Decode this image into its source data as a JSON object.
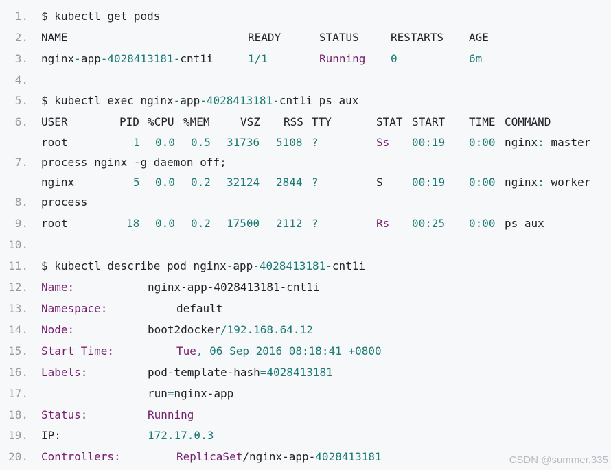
{
  "line_numbers": [
    "1.",
    "2.",
    "3.",
    "4.",
    "5.",
    "6.",
    "7.",
    "8.",
    "9.",
    "10.",
    "11.",
    "12.",
    "13.",
    "14.",
    "15.",
    "16.",
    "17.",
    "18.",
    "19.",
    "20."
  ],
  "cmd1": "$ kubectl get pods",
  "pods_header": {
    "name": "NAME",
    "ready": "READY",
    "status": "STATUS",
    "restarts": "RESTARTS",
    "age": "AGE"
  },
  "pod_row": {
    "name_a": "nginx",
    "sep1": "-",
    "name_b": "app",
    "sep2": "-",
    "name_c": "4028413181",
    "sep3": "-",
    "name_d": "cnt1i",
    "ready": "1/1",
    "status": "Running",
    "restarts": "0",
    "age": "6m"
  },
  "cmd2": {
    "a": "$ kubectl exec nginx",
    "b": "-",
    "c": "app",
    "d": "-",
    "e": "4028413181",
    "f": "-",
    "g": "cnt1i ps aux"
  },
  "ps_header": {
    "user": "USER",
    "pid": "PID",
    "cpu": "%CPU",
    "mem": "%MEM",
    "vsz": "VSZ",
    "rss": "RSS",
    "tty": "TTY",
    "stat": "STAT",
    "start": "START",
    "time": "TIME",
    "command": "COMMAND"
  },
  "ps_rows": [
    {
      "user": "root",
      "pid": "1",
      "cpu": "0.0",
      "mem": "0.5",
      "vsz": "31736",
      "rss": "5108",
      "tty": "?",
      "stat": "Ss",
      "start": "00:19",
      "time": "0:00",
      "cmd_a": "nginx",
      "cmd_b": ":",
      "cmd_c": " master",
      "wrap": "process nginx -g daemon off;"
    },
    {
      "user": "nginx",
      "pid": "5",
      "cpu": "0.0",
      "mem": "0.2",
      "vsz": "32124",
      "rss": "2844",
      "tty": "?",
      "stat": "S",
      "start": "00:19",
      "time": "0:00",
      "cmd_a": "nginx",
      "cmd_b": ":",
      "cmd_c": " worker",
      "wrap": "process"
    },
    {
      "user": "root",
      "pid": "18",
      "cpu": "0.0",
      "mem": "0.2",
      "vsz": "17500",
      "rss": "2112",
      "tty": "?",
      "stat": "Rs",
      "start": "00:25",
      "time": "0:00",
      "cmd_a": "ps aux",
      "cmd_b": "",
      "cmd_c": "",
      "wrap": ""
    }
  ],
  "cmd3": {
    "a": "$ kubectl describe pod nginx",
    "b": "-",
    "c": "app",
    "d": "-",
    "e": "4028413181",
    "f": "-",
    "g": "cnt1i"
  },
  "describe": {
    "name_label": "Name:",
    "name_value": "nginx-app-4028413181-cnt1i",
    "namespace_label": "Namespace:",
    "namespace_value": "default",
    "node_label": "Node:",
    "node_value_a": "boot2docker",
    "node_value_b": "/192.168.64.12",
    "start_label": "Start Time:",
    "start_value_a": "Tue",
    "start_value_b": ", ",
    "start_value_c": "06 Sep 2016 08:18:41 +0800",
    "labels_label": "Labels:",
    "labels_value1_a": "pod-template-hash",
    "labels_value1_b": "=4028413181",
    "labels_value2_a": "run",
    "labels_value2_b": "=",
    "labels_value2_c": "nginx-app",
    "status_label": "Status:",
    "status_value": "Running",
    "ip_label": "IP:",
    "ip_value": "172.17.0.3",
    "controllers_label": "Controllers:",
    "controllers_value_a": "ReplicaSet",
    "controllers_value_b": "/nginx-app-",
    "controllers_value_c": "4028413181"
  },
  "watermark": "CSDN @summer.335"
}
